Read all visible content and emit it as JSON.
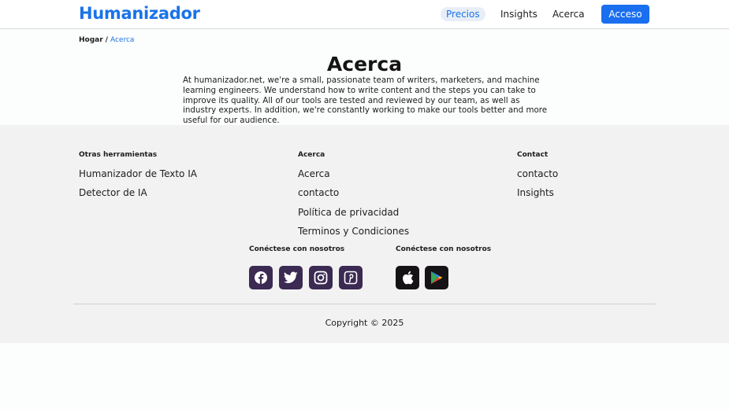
{
  "header": {
    "logo": "Humanizador",
    "nav": [
      "Precios",
      "Insights",
      "Acerca"
    ],
    "login_label": "Acceso"
  },
  "breadcrumb": {
    "home": "Hogar",
    "separator": "/",
    "current": "Acerca"
  },
  "main": {
    "title": "Acerca",
    "description": "At humanizador.net, we're a small, passionate team of writers, marketers, and machine learning engineers. We understand how to write content and the steps you can take to improve its quality. All of our tools are tested and reviewed by our team, as well as industry experts. In addition, we're constantly working to make our tools better and more useful for our audience."
  },
  "footer": {
    "columns": [
      {
        "heading": "Otras herramientas",
        "links": [
          "Humanizador de Texto IA",
          "Detector de IA"
        ]
      },
      {
        "heading": "Acerca",
        "links": [
          "Acerca",
          "contacto",
          "Política de privacidad",
          "Terminos y Condiciones"
        ]
      },
      {
        "heading": "Contact",
        "links": [
          "contacto",
          "Insights"
        ]
      }
    ],
    "social_heading": "Conéctese con nosotros",
    "apps_heading": "Conéctese con nosotros",
    "social_icons": [
      "facebook-icon",
      "twitter-icon",
      "instagram-icon",
      "pinterest-icon"
    ],
    "app_icons": [
      "apple-icon",
      "google-play-icon"
    ],
    "copyright": "Copyright © 2025"
  },
  "colors": {
    "brand": "#1a73e8",
    "button": "#1a6ef0",
    "social_bg": "#3b2a52",
    "footer_bg": "#f2f2f3"
  }
}
